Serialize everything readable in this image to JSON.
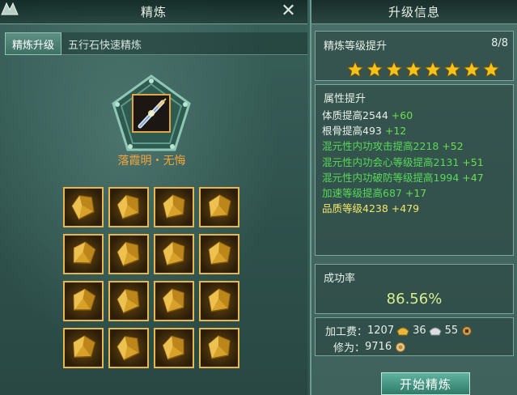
{
  "left_panel": {
    "title": "精炼",
    "close_symbol": "✕",
    "tabs": [
      {
        "label": "精炼升级",
        "active": true
      },
      {
        "label": "五行石快速精炼",
        "active": false
      }
    ],
    "item": {
      "name": "落霞明・无悔",
      "icon": "sword-icon"
    },
    "materials_icon": "gold-ore-icon",
    "materials_count": 16
  },
  "right_panel": {
    "title": "升级信息",
    "upgrade": {
      "label": "精炼等级提升",
      "count": "8/8",
      "stars_filled": 8,
      "star_color": "#f5c21b"
    },
    "attributes": {
      "title": "属性提升",
      "lines": [
        {
          "base": "体质提高2544",
          "bonus": "+60",
          "style": "white"
        },
        {
          "base": "根骨提高493",
          "bonus": "+12",
          "style": "white"
        },
        {
          "base": "混元性内功攻击提高2218",
          "bonus": "+52",
          "style": "green"
        },
        {
          "base": "混元性内功会心等级提高2131",
          "bonus": "+51",
          "style": "green"
        },
        {
          "base": "混元性内功破防等级提高1994",
          "bonus": "+47",
          "style": "green"
        },
        {
          "base": "加速等级提高687",
          "bonus": "+17",
          "style": "green"
        },
        {
          "base": "品质等级4238",
          "bonus": "+479",
          "style": "yellow"
        }
      ]
    },
    "success": {
      "label": "成功率",
      "value": "86.56%"
    },
    "cost": {
      "label": "加工费：",
      "gold": "1207",
      "silver": "36",
      "copper": "55",
      "cultivation_label": "修为：",
      "cultivation_value": "9716"
    },
    "start_button": "开始精炼"
  },
  "colors": {
    "bonus_green": "#69e04b",
    "attr_green": "#56d956",
    "quality_yellow": "#f4e868",
    "item_name_orange": "#f0a43b"
  }
}
